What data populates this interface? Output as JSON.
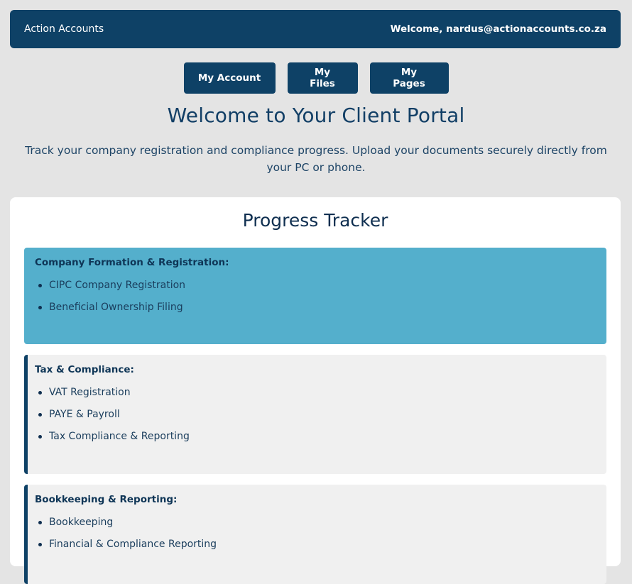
{
  "header": {
    "brand": "Action Accounts",
    "welcome": "Welcome, nardus@actionaccounts.co.za"
  },
  "nav": {
    "my_account": "My Account",
    "my_files": "My Files",
    "my_pages": "My Pages"
  },
  "main": {
    "title": "Welcome to Your Client Portal",
    "intro": "Track your company registration and compliance progress. Upload your documents securely directly from your PC or phone."
  },
  "tracker": {
    "title": "Progress Tracker",
    "sections": [
      {
        "title": "Company Formation & Registration:",
        "items": [
          "CIPC Company Registration",
          "Beneficial Ownership Filing"
        ]
      },
      {
        "title": "Tax & Compliance:",
        "items": [
          "VAT Registration",
          "PAYE & Payroll",
          "Tax Compliance & Reporting"
        ]
      },
      {
        "title": "Bookkeeping & Reporting:",
        "items": [
          "Bookkeeping",
          "Financial & Compliance Reporting"
        ]
      }
    ]
  },
  "colors": {
    "primary": "#0e4166",
    "active_section": "#54afcc",
    "inactive_section": "#f0f0f0",
    "page_bg": "#e4e4e4"
  }
}
